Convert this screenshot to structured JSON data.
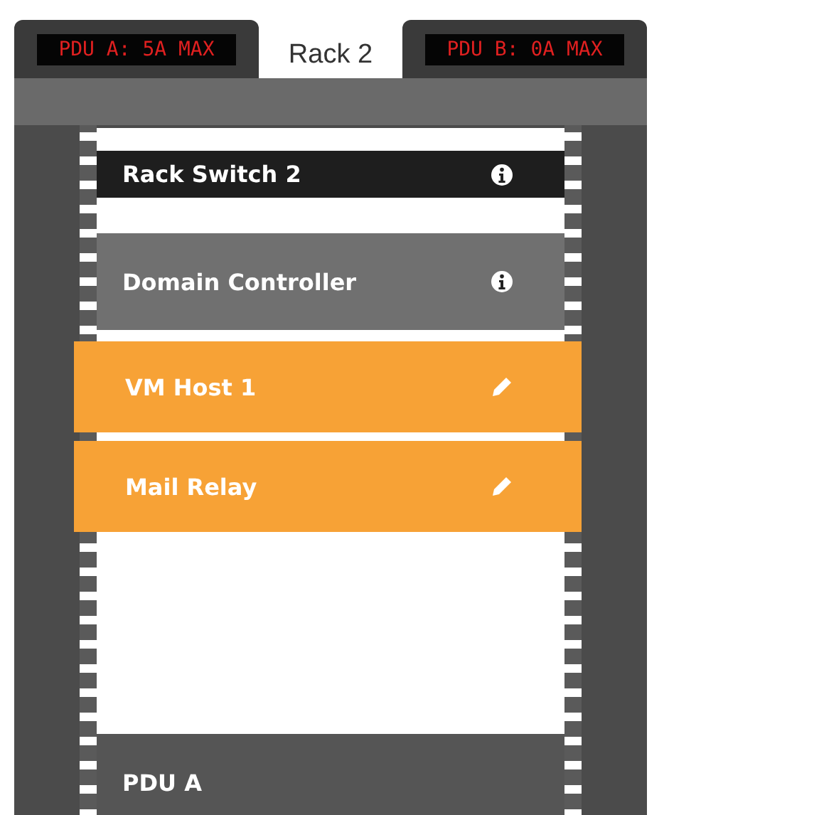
{
  "tabs": [
    {
      "kind": "display",
      "label": "PDU A: 5A MAX",
      "selected": false
    },
    {
      "kind": "title",
      "label": "Rack 2",
      "selected": true
    },
    {
      "kind": "display",
      "label": "PDU B: 0A MAX",
      "selected": false
    }
  ],
  "rack": {
    "slots": [
      {
        "kind": "switch",
        "name": "Rack Switch 2"
      },
      {
        "kind": "server",
        "name": "Domain Controller"
      },
      {
        "kind": "vm",
        "name": "VM Host 1"
      },
      {
        "kind": "vm",
        "name": "Mail Relay"
      },
      {
        "kind": "pdu",
        "name": "PDU A"
      }
    ]
  }
}
